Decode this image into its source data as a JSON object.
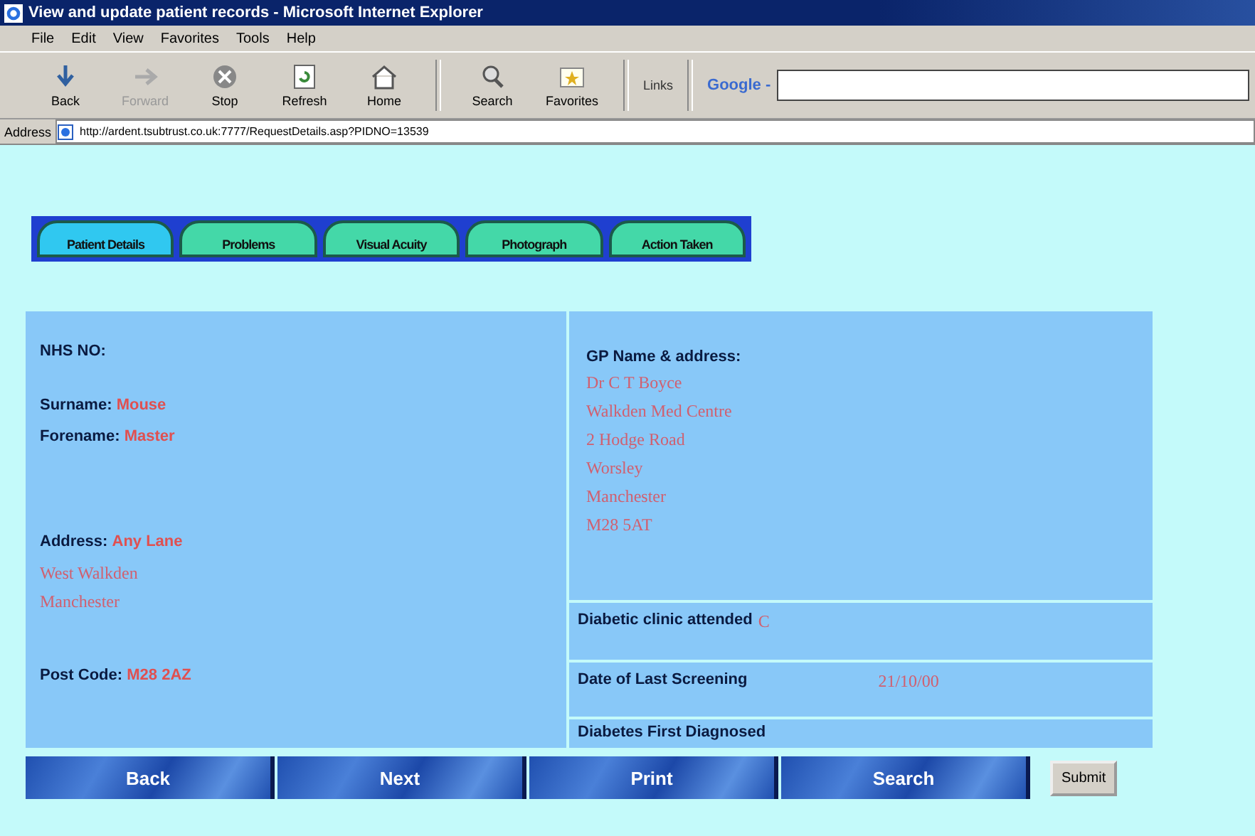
{
  "window": {
    "title": "View and update patient records - Microsoft Internet Explorer"
  },
  "menu": [
    "File",
    "Edit",
    "View",
    "Favorites",
    "Tools",
    "Help"
  ],
  "toolbar": [
    {
      "label": "Back",
      "disabled": false
    },
    {
      "label": "Forward",
      "disabled": true
    },
    {
      "label": "Stop",
      "disabled": false
    },
    {
      "label": "Refresh",
      "disabled": false
    },
    {
      "label": "Home",
      "disabled": false
    },
    {
      "label": "Search",
      "disabled": false
    },
    {
      "label": "Favorites",
      "disabled": false
    }
  ],
  "links": "Links",
  "google": "Google -",
  "address": {
    "label": "Address",
    "url": "http://ardent.tsubtrust.co.uk:7777/RequestDetails.asp?PIDNO=13539"
  },
  "tabs": [
    {
      "label": "Patient Details",
      "selected": true
    },
    {
      "label": "Problems",
      "selected": false
    },
    {
      "label": "Visual Acuity",
      "selected": false
    },
    {
      "label": "Photograph",
      "selected": false
    },
    {
      "label": "Action Taken",
      "selected": false
    }
  ],
  "patient": {
    "nhs_label": "NHS NO:",
    "surname": {
      "label": "Surname:",
      "value": "Mouse"
    },
    "forename": {
      "label": "Forename:",
      "value": "Master"
    },
    "address": {
      "label": "Address:",
      "value": "Any Lane",
      "lines": [
        "West Walkden",
        "Manchester"
      ]
    },
    "postcode": {
      "label": "Post Code:",
      "value": "M28 2AZ"
    }
  },
  "gp": {
    "label": "GP Name & address:",
    "lines": [
      "Dr C T Boyce",
      "Walkden Med Centre",
      "2 Hodge Road",
      "Worsley",
      "Manchester",
      "M28 5AT"
    ]
  },
  "rows": [
    {
      "label": "Diabetic clinic attended",
      "value": "C"
    },
    {
      "label": "Date of Last Screening",
      "value": "21/10/00"
    },
    {
      "label": "Diabetes First Diagnosed"
    }
  ],
  "buttons": [
    {
      "label": "Back",
      "kind": "image"
    },
    {
      "label": "Next",
      "kind": "image"
    },
    {
      "label": "Print",
      "kind": "image"
    },
    {
      "label": "Search",
      "kind": "image"
    },
    {
      "label": "Submit",
      "kind": "plain"
    }
  ]
}
